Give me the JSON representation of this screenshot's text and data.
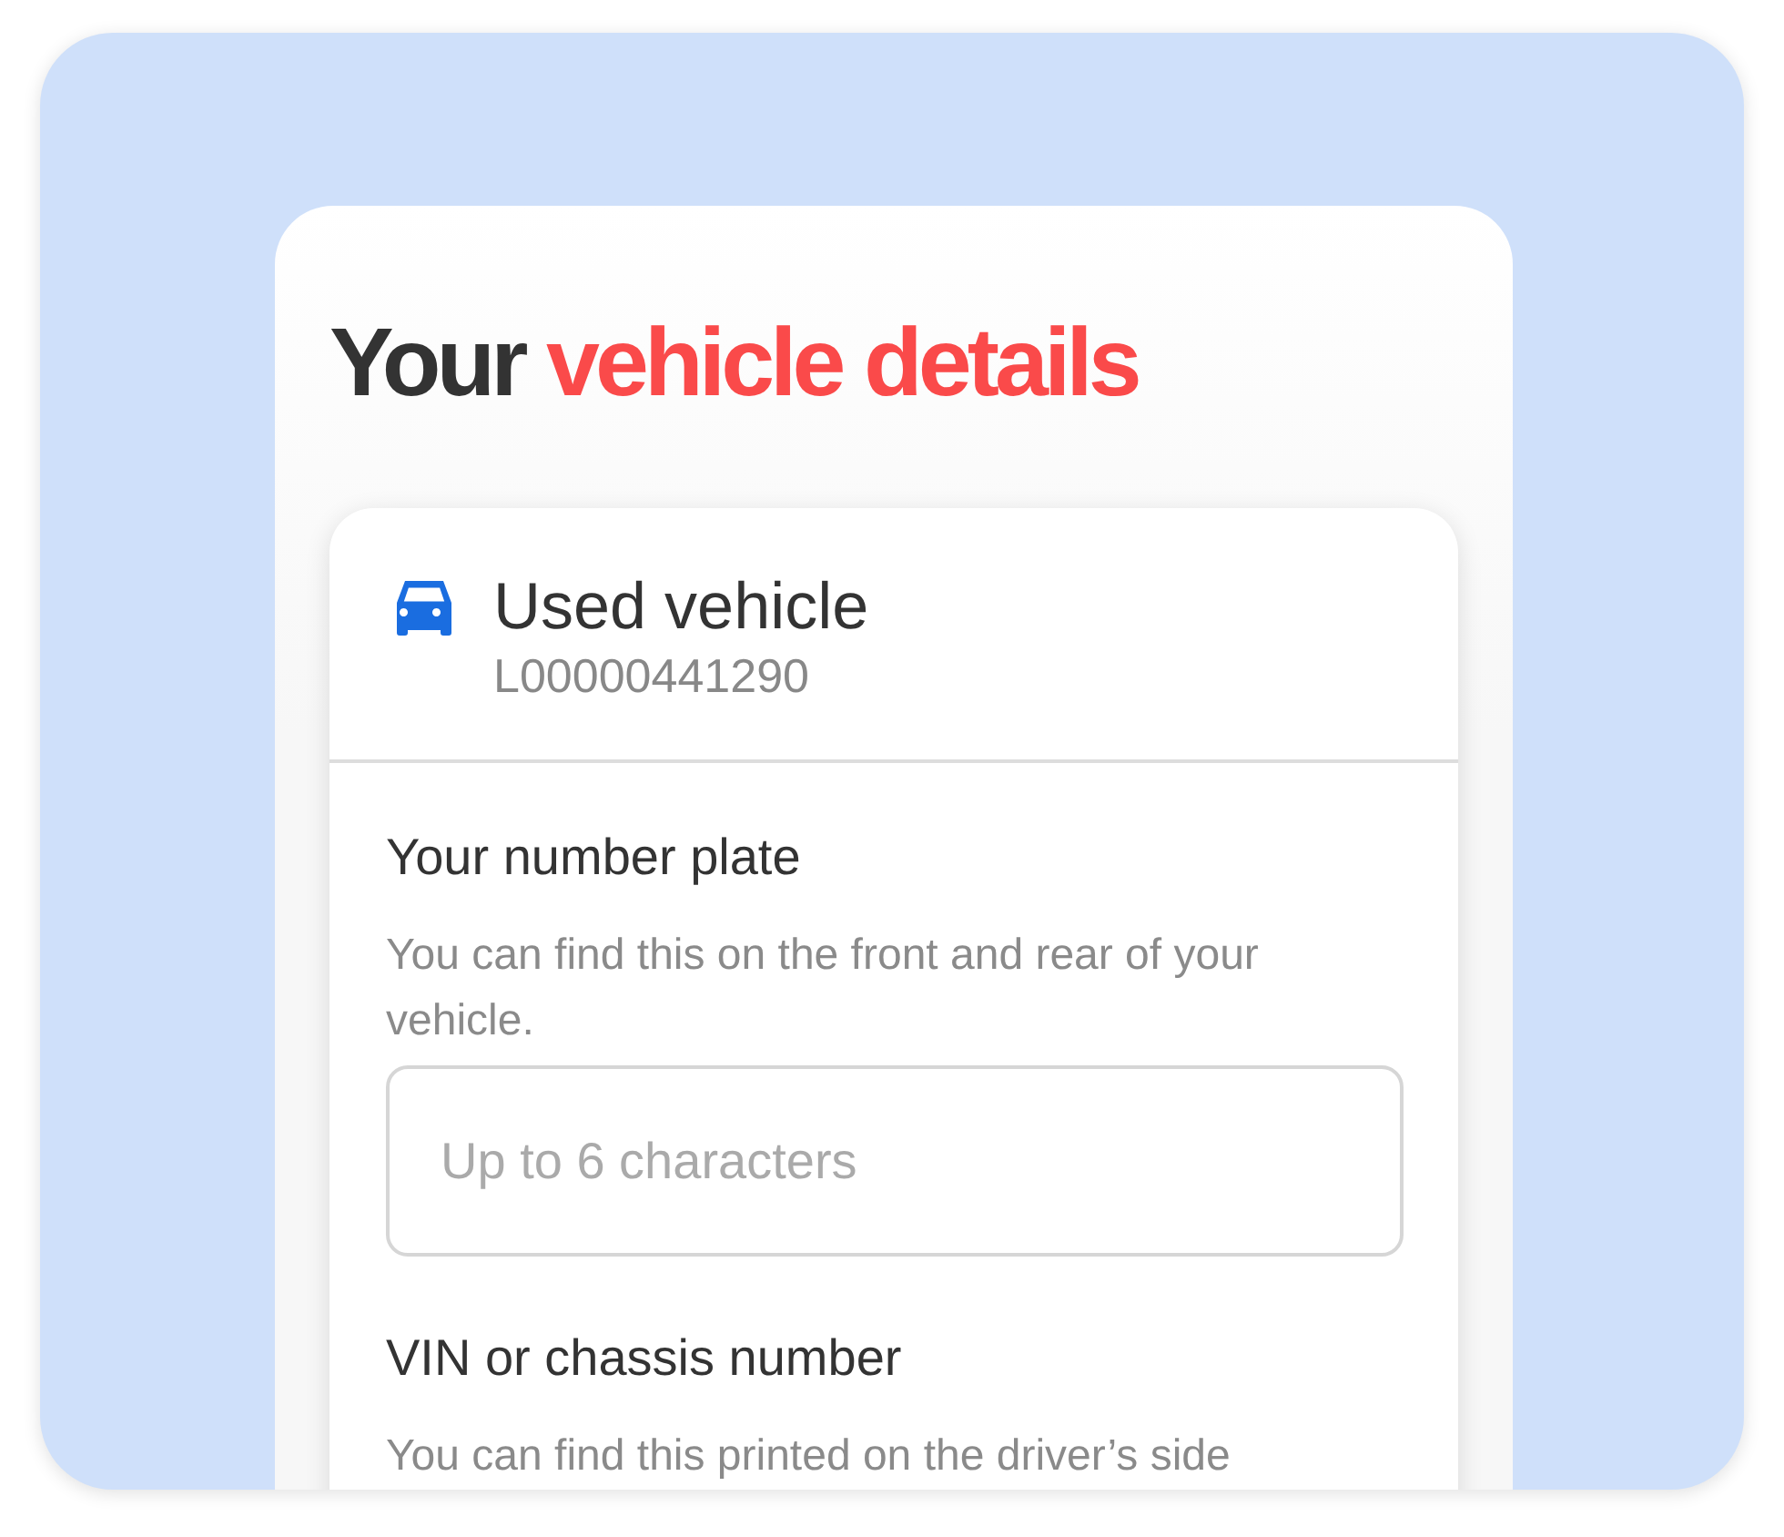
{
  "heading": {
    "lead": "Your",
    "highlight": "vehicle details"
  },
  "vehicle": {
    "title": "Used vehicle",
    "reference": "L00000441290"
  },
  "fields": [
    {
      "label": "Your number plate",
      "help": "You can find this on the front and rear of your vehicle.",
      "placeholder": "Up to 6 characters"
    },
    {
      "label": "VIN or chassis number",
      "help": "You can find this printed on the driver’s side"
    }
  ]
}
